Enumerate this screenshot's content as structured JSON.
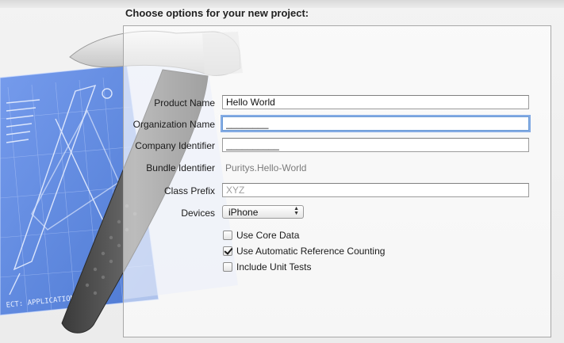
{
  "dialog": {
    "heading": "Choose options for your new project:"
  },
  "form": {
    "product_name": {
      "label": "Product Name",
      "value": "Hello World"
    },
    "organization_name": {
      "label": "Organization Name",
      "value": "________"
    },
    "company_identifier": {
      "label": "Company Identifier",
      "value": "__________"
    },
    "bundle_identifier": {
      "label": "Bundle Identifier",
      "value": "Puritys.Hello-World"
    },
    "class_prefix": {
      "label": "Class Prefix",
      "placeholder": "XYZ"
    },
    "devices": {
      "label": "Devices",
      "selected": "iPhone"
    },
    "options": [
      {
        "label": "Use Core Data",
        "checked": false
      },
      {
        "label": "Use Automatic Reference Counting",
        "checked": true
      },
      {
        "label": "Include Unit Tests",
        "checked": false
      }
    ]
  },
  "colors": {
    "blueprint": "#4a78d8",
    "focus_ring": "#5e92dd",
    "panel_border": "#a8a8a8"
  },
  "icons": {
    "artwork": "xcode-hammer-blueprint-icon",
    "devices_popup": "up-down-arrows-icon",
    "check": "checkmark-icon"
  },
  "artwork": {
    "blueprint_caption": "ECT: APPLICATION.APP"
  }
}
